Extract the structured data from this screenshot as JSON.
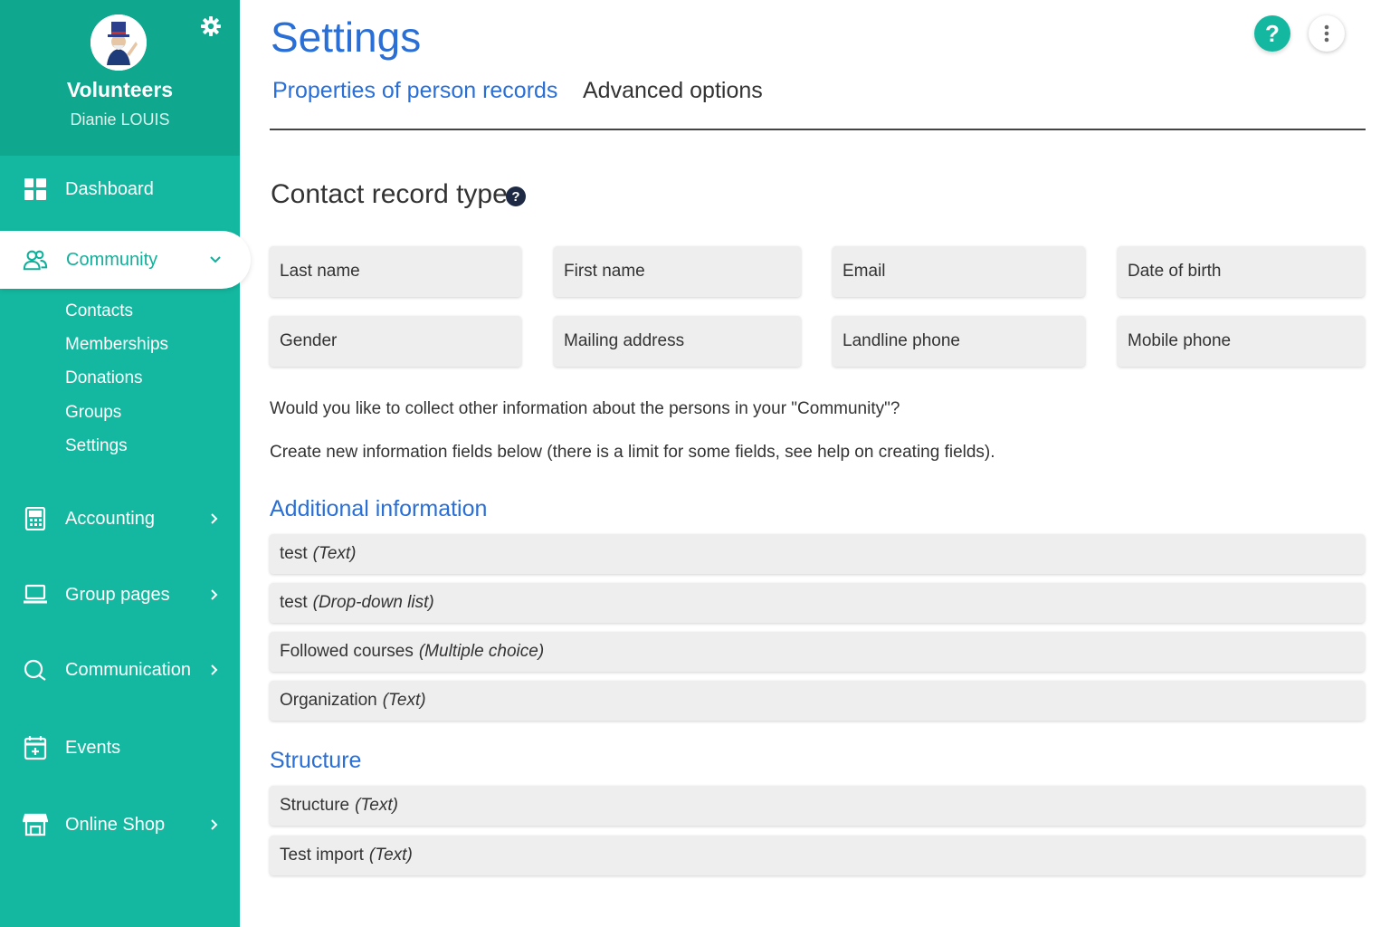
{
  "sidebar": {
    "org_name": "Volunteers",
    "user_name": "Dianie LOUIS",
    "nav": {
      "dashboard": "Dashboard",
      "community": "Community",
      "accounting": "Accounting",
      "group_pages": "Group pages",
      "communication": "Communication",
      "events": "Events",
      "online_shop": "Online Shop"
    },
    "community_sub": [
      "Contacts",
      "Memberships",
      "Donations",
      "Groups",
      "Settings"
    ]
  },
  "header": {
    "title": "Settings",
    "help_label": "?",
    "tabs": [
      "Properties of person records",
      "Advanced options"
    ]
  },
  "contact_section": {
    "title": "Contact record type",
    "help_label": "?",
    "fields": [
      "Last name",
      "First name",
      "Email",
      "Date of birth",
      "Gender",
      "Mailing address",
      "Landline phone",
      "Mobile phone"
    ]
  },
  "info": {
    "line1": "Would you like to collect other information about the persons in your \"Community\"?",
    "line2": "Create new information fields below (there is a limit for some fields, see help on creating fields)."
  },
  "additional": {
    "title": "Additional information",
    "fields": [
      {
        "name": "test",
        "type": "(Text)"
      },
      {
        "name": "test",
        "type": "(Drop-down list)"
      },
      {
        "name": "Followed courses",
        "type": "(Multiple choice)"
      },
      {
        "name": "Organization",
        "type": "(Text)"
      }
    ]
  },
  "structure": {
    "title": "Structure",
    "fields": [
      {
        "name": "Structure",
        "type": "(Text)"
      },
      {
        "name": "Test import",
        "type": "(Text)"
      }
    ]
  },
  "colors": {
    "sidebar": "#14b8a0",
    "sidebar_header": "#0fa88f",
    "accent_blue": "#2a6fd6"
  }
}
